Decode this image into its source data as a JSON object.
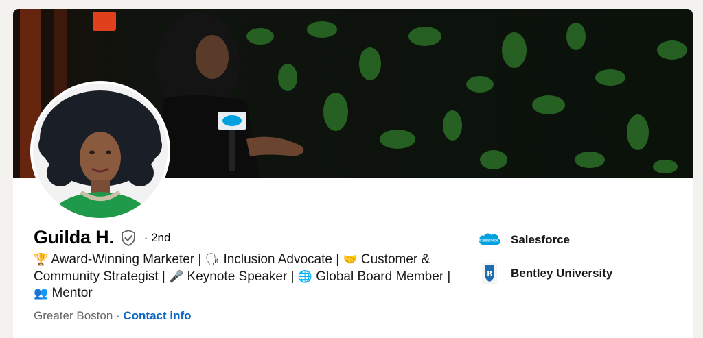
{
  "profile": {
    "name": "Guilda H.",
    "degree": "· 2nd",
    "headline_parts": [
      {
        "icon": "🏆",
        "icon_name": "trophy-icon",
        "text": " Award-Winning Marketer | "
      },
      {
        "icon": "🗣",
        "icon_name": "speaking-head-icon",
        "text": " Inclusion Advocate | "
      },
      {
        "icon": "🤝",
        "icon_name": "handshake-icon",
        "text": " Customer & Community Strategist | "
      },
      {
        "icon": "🎤",
        "icon_name": "microphone-icon",
        "text": " Keynote Speaker | "
      },
      {
        "icon": "🌐",
        "icon_name": "globe-icon",
        "text": " Global Board Member | "
      },
      {
        "icon": "👥",
        "icon_name": "people-icon",
        "text": " Mentor"
      }
    ],
    "location": "Greater Boston",
    "separator": " · ",
    "contact_label": "Contact info"
  },
  "experience": [
    {
      "name": "Salesforce",
      "logo_text": "salesforce",
      "logo_color": "#00a1e0",
      "icon_name": "salesforce-logo-icon"
    },
    {
      "name": "Bentley University",
      "logo_text": "B",
      "logo_color": "#1f6db5",
      "icon_name": "bentley-shield-icon"
    }
  ],
  "colors": {
    "link": "#0a66c2",
    "banner_dark": "#0d130c",
    "banner_green": "#2f7a2a"
  }
}
